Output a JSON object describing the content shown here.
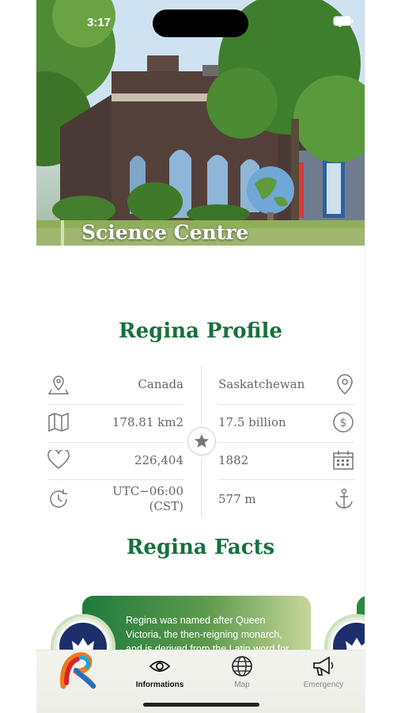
{
  "status_bar": {
    "time": "3:17"
  },
  "hero": {
    "title": "Science Centre"
  },
  "profile": {
    "title": "Regina Profile",
    "rows": [
      {
        "left_value": "Canada",
        "left_icon": "location-pin-map-icon",
        "right_value": "Saskatchewan",
        "right_icon": "location-pin-icon"
      },
      {
        "left_value": "178.81 km2",
        "left_icon": "map-icon",
        "right_value": "17.5 billion",
        "right_icon": "dollar-coin-icon"
      },
      {
        "left_value": "226,404",
        "left_icon": "heart-icon",
        "right_value": "1882",
        "right_icon": "calendar-icon"
      },
      {
        "left_value_line1": "UTC−06:00",
        "left_value_line2": "(CST)",
        "left_icon": "clock-icon",
        "right_value": "577 m",
        "right_icon": "anchor-icon"
      }
    ]
  },
  "facts": {
    "title": "Regina Facts",
    "cards": [
      {
        "text": "Regina was named after Queen Victoria, the then-reigning monarch, and is derived from the Latin word for"
      }
    ]
  },
  "tabbar": {
    "tabs": [
      {
        "label": "",
        "icon": "app-logo-icon"
      },
      {
        "label": "Informations",
        "icon": "eye-icon",
        "active": true
      },
      {
        "label": "Map",
        "icon": "globe-icon"
      },
      {
        "label": "Emergency",
        "icon": "megaphone-icon"
      }
    ]
  },
  "colors": {
    "accent": "#17703d",
    "text_muted": "#666666"
  }
}
